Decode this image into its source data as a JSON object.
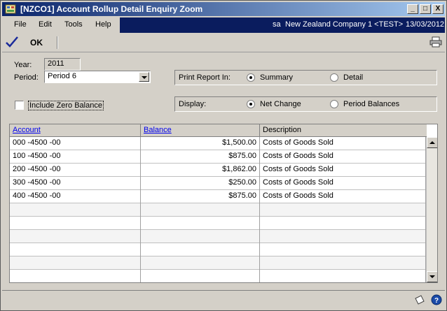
{
  "window": {
    "title": "[NZCO1] Account Rollup Detail Enquiry Zoom",
    "min_label": "_",
    "max_label": "□",
    "close_label": "X"
  },
  "menu": {
    "items": [
      "File",
      "Edit",
      "Tools",
      "Help"
    ],
    "user": "sa",
    "company": "New Zealand Company 1 <TEST>",
    "date": "13/03/2012"
  },
  "toolbar": {
    "ok_label": "OK"
  },
  "form": {
    "year_label": "Year:",
    "year_value": "2011",
    "period_label": "Period:",
    "period_value": "Period 6",
    "include_zero_label": "Include Zero Balance",
    "print_report_label": "Print Report In:",
    "print_options": [
      "Summary",
      "Detail"
    ],
    "print_selected": "Summary",
    "display_label": "Display:",
    "display_options": [
      "Net Change",
      "Period Balances"
    ],
    "display_selected": "Net Change"
  },
  "grid": {
    "headers": [
      "Account",
      "Balance",
      "Description"
    ],
    "rows": [
      [
        "000 -4500 -00",
        "$1,500.00",
        "Costs of Goods Sold"
      ],
      [
        "100 -4500 -00",
        "$875.00",
        "Costs of Goods Sold"
      ],
      [
        "200 -4500 -00",
        "$1,862.00",
        "Costs of Goods Sold"
      ],
      [
        "300 -4500 -00",
        "$250.00",
        "Costs of Goods Sold"
      ],
      [
        "400 -4500 -00",
        "$875.00",
        "Costs of Goods Sold"
      ]
    ],
    "empty_rows": 6
  },
  "status": {
    "icons": [
      "note-icon",
      "help-icon"
    ]
  },
  "colors": {
    "title_start": "#0a246a",
    "title_end": "#a6caf0",
    "link": "#0000ee"
  }
}
